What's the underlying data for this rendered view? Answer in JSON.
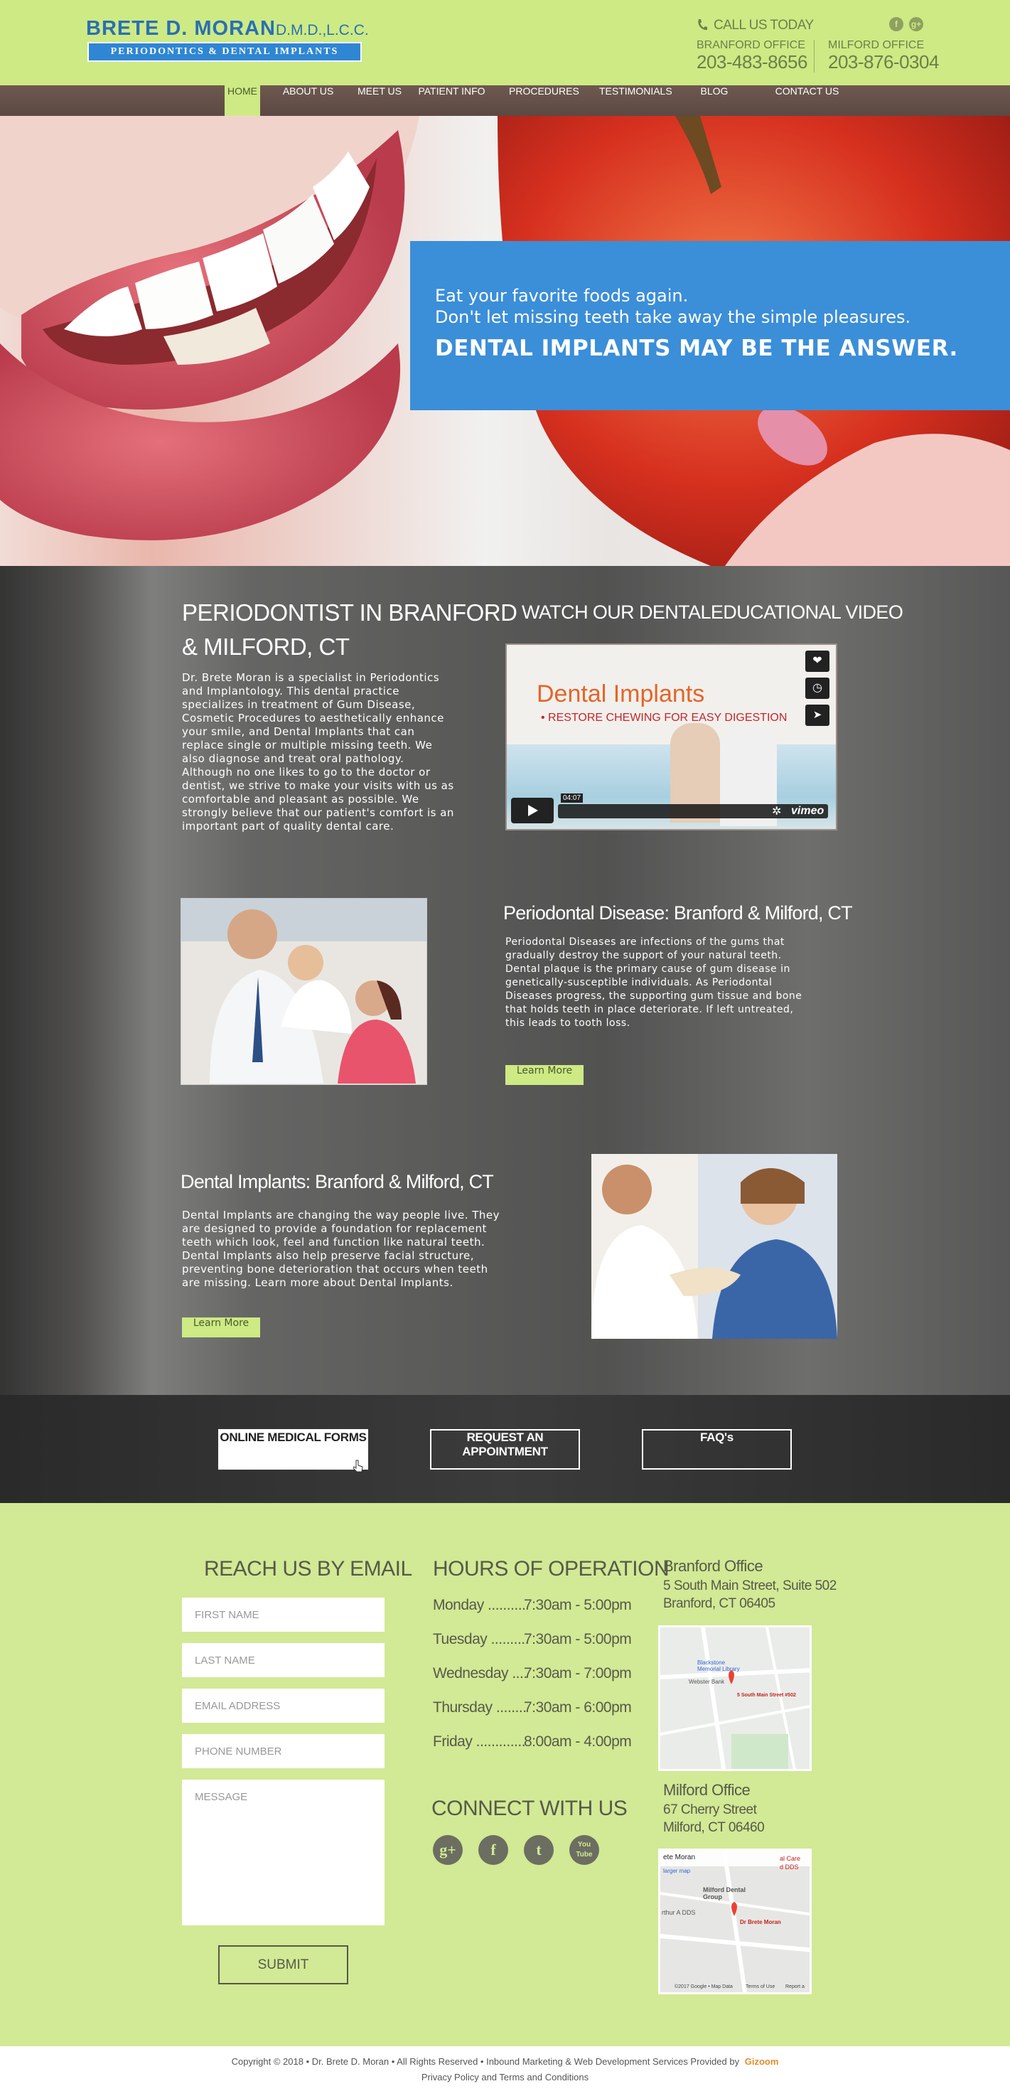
{
  "header": {
    "logo_name": "BRETE D. MORAN",
    "logo_credentials": "D.M.D.,L.C.C.",
    "logo_tagline": "PERIODONTICS & DENTAL IMPLANTS",
    "call_label": "CALL US TODAY",
    "offices": [
      {
        "label": "BRANFORD OFFICE",
        "phone": "203-483-8656"
      },
      {
        "label": "MILFORD OFFICE",
        "phone": "203-876-0304"
      }
    ],
    "social_small": [
      "f",
      "g+"
    ]
  },
  "nav": {
    "items": [
      "HOME",
      "ABOUT US",
      "MEET US",
      "PATIENT INFO",
      "PROCEDURES",
      "TESTIMONIALS",
      "BLOG",
      "CONTACT US"
    ],
    "active": "HOME"
  },
  "hero": {
    "line1": "Eat your favorite foods again.",
    "line2": "Don't let missing teeth take away the simple pleasures.",
    "strong": "DENTAL IMPLANTS MAY BE THE ANSWER."
  },
  "intro": {
    "title_line1": "PERIODONTIST IN BRANFORD",
    "title_line2": "& MILFORD, CT",
    "paragraph_lines": [
      "Dr. Brete Moran is a specialist in Periodontics",
      "and Implantology. This dental practice",
      "specializes in treatment of Gum Disease,",
      "Cosmetic Procedures to aesthetically enhance",
      "your smile, and Dental Implants that can",
      "replace single or multiple missing teeth. We",
      "also diagnose and treat oral pathology.",
      "Although no one likes to go to the doctor or",
      "dentist, we strive to make your visits with us as",
      "comfortable and pleasant as possible. We",
      "strongly believe that our patient's comfort is an",
      "important part of quality dental care."
    ]
  },
  "video": {
    "heading": "WATCH OUR DENTALEDUCATIONAL VIDEO",
    "title": "Dental Implants",
    "subtitle": "• RESTORE CHEWING FOR EASY DIGESTION",
    "time": "04:07",
    "brand": "vimeo"
  },
  "perio": {
    "title": "Periodontal Disease: Branford & Milford, CT",
    "paragraph_lines": [
      "Periodontal Diseases are infections of the gums that",
      "gradually destroy the support of your natural teeth.",
      "Dental plaque is the primary cause of gum disease in",
      "genetically-susceptible individuals. As Periodontal",
      "Diseases progress, the supporting gum tissue and bone",
      "that holds teeth in place deteriorate. If left untreated,",
      "this leads to tooth loss."
    ],
    "button": "Learn More"
  },
  "implants": {
    "title": "Dental Implants: Branford & Milford, CT",
    "paragraph_lines": [
      "Dental Implants are changing the way people live. They",
      "are designed to provide a foundation for replacement",
      "teeth which look, feel and function like natural teeth.",
      "Dental Implants also help preserve facial structure,",
      "preventing bone deterioration that occurs when teeth",
      "are missing. Learn more about Dental Implants."
    ],
    "button": "Learn More"
  },
  "cta": {
    "buttons": [
      "ONLINE MEDICAL FORMS",
      "REQUEST AN APPOINTMENT",
      "FAQ's"
    ]
  },
  "contact_form": {
    "heading": "REACH US BY EMAIL",
    "placeholders": {
      "first_name": "FIRST NAME",
      "last_name": "LAST NAME",
      "email": "EMAIL ADDRESS",
      "phone": "PHONE NUMBER",
      "message": "MESSAGE"
    },
    "submit": "SUBMIT"
  },
  "hours": {
    "heading": "HOURS OF OPERATION",
    "rows": [
      {
        "day": "Monday ..........",
        "time": "7:30am - 5:00pm"
      },
      {
        "day": "Tuesday ..........",
        "time": "7:30am - 5:00pm"
      },
      {
        "day": "Wednesday ....",
        "time": "7:30am - 7:00pm"
      },
      {
        "day": "Thursday ........",
        "time": "7:30am - 6:00pm"
      },
      {
        "day": "Friday .............",
        "time": "8:00am - 4:00pm"
      }
    ]
  },
  "connect": {
    "heading": "CONNECT WITH US",
    "icons": [
      "g+",
      "f",
      "t",
      "You Tube"
    ]
  },
  "locations": [
    {
      "name": "Branford Office",
      "street": "5 South Main Street, Suite 502",
      "city": "Branford, CT 06405",
      "map_labels": [
        "Blackstone Memorial Library",
        "Webster Bank",
        "5 South Main Street #502"
      ]
    },
    {
      "name": "Milford Office",
      "street": "67 Cherry Street",
      "city": "Milford, CT 06460",
      "map_labels": [
        "ete Moran",
        "larger map",
        "Milford Dental Group",
        "rthur A DDS",
        "Dr Brete Moran",
        "al Care",
        "d DDS",
        "©2017 Google • Map Data",
        "Terms of Use",
        "Report a"
      ]
    }
  ],
  "footer": {
    "copyright": "Copyright © 2018 • Dr. Brete D. Moran • All Rights Reserved • Inbound Marketing & Web Development Services Provided by",
    "brand": "Gizoom",
    "links": "Privacy Policy and Terms and Conditions"
  },
  "colors": {
    "lime": "#cdea84",
    "blue": "#3b8ed8",
    "nav_brown": "#6e5950",
    "dark_text": "#565a4a"
  }
}
